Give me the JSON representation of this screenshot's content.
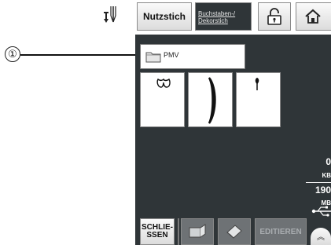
{
  "callout": {
    "number": "①"
  },
  "toolbar": {
    "utility_stitch_label": "Nutzstich",
    "char_deco_line1": "Buchstaben-/",
    "char_deco_line2": "Dekorstich"
  },
  "folder": {
    "name": "PMV"
  },
  "right_panel": {
    "value1": "0",
    "unit1": "KB",
    "value2": "190",
    "unit2": "MB"
  },
  "bottom": {
    "close_line1": "SCHLIE-",
    "close_line2": "SSEN",
    "edit_label": "EDITIEREN",
    "scroll_up_glyph": "︽"
  },
  "icons": {
    "presser": "presser-foot-icon",
    "lock": "lock-icon",
    "home": "home-icon",
    "folder": "folder-icon",
    "usb": "usb-icon"
  }
}
